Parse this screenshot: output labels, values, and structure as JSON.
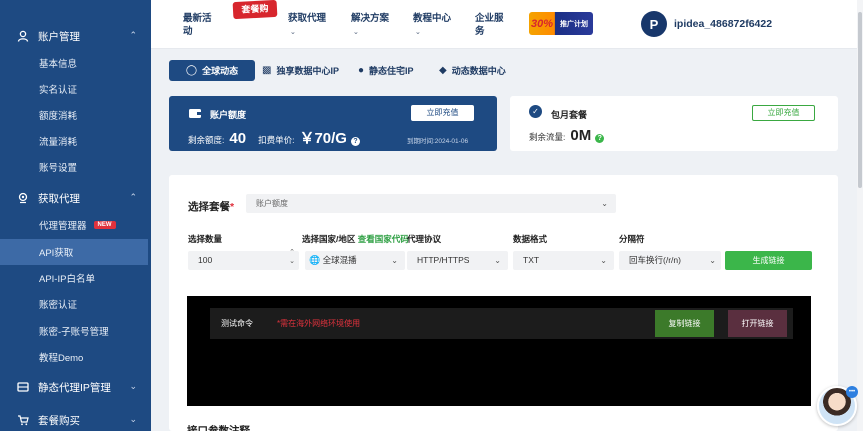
{
  "sidebar": {
    "groups": [
      {
        "label": "账户管理",
        "icon": "user-icon"
      },
      {
        "label": "获取代理",
        "icon": "location-pin-icon"
      },
      {
        "label": "静态代理IP管理",
        "icon": "server-icon"
      },
      {
        "label": "套餐购买",
        "icon": "cart-icon"
      }
    ],
    "account_items": [
      "基本信息",
      "实名认证",
      "额度消耗",
      "流量消耗",
      "账号设置"
    ],
    "proxy_items": [
      "代理管理器",
      "API获取",
      "API-IP白名单",
      "账密认证",
      "账密-子账号管理",
      "教程Demo"
    ],
    "new_badge": "NEW"
  },
  "topbar": {
    "nav": [
      {
        "label": "最新活\n动",
        "has_chevron": false
      },
      {
        "label": "获取代理",
        "has_chevron": true
      },
      {
        "label": "解决方案",
        "has_chevron": true
      },
      {
        "label": "教程中心",
        "has_chevron": true
      },
      {
        "label": "企业服\n务",
        "has_chevron": false
      }
    ],
    "promo_badge": "套餐购",
    "banner_num": "30%",
    "banner_text": "推广计划",
    "logo_letter": "P",
    "username": "ipidea_486872f6422"
  },
  "tabs": [
    {
      "label": "全球动态",
      "icon": "globe-icon"
    },
    {
      "label": "独享数据中心IP",
      "icon": "datacenter-icon"
    },
    {
      "label": "静态住宅IP",
      "icon": "bulb-icon"
    },
    {
      "label": "动态数据中心",
      "icon": "layers-icon"
    }
  ],
  "account_card": {
    "title": "账户额度",
    "button": "立即充值",
    "remaining_label": "剩余额度:",
    "remaining_value": "40",
    "price_label": "扣费单价:",
    "price_value": "￥70/G",
    "expiry": "到期时间:2024-01-06"
  },
  "monthly_card": {
    "title": "包月套餐",
    "button": "立即充值",
    "traffic_label": "剩余流量:",
    "traffic_value": "0M"
  },
  "form": {
    "package_label": "选择套餐",
    "package_required": "*",
    "package_value": "账户额度",
    "quantity_label": "选择数量",
    "quantity_value": "100",
    "region_label": "选择国家/地区",
    "region_link": "查看国家代码",
    "region_value": "全球混播",
    "protocol_label": "代理协议",
    "protocol_value": "HTTP/HTTPS",
    "format_label": "数据格式",
    "format_value": "TXT",
    "separator_label": "分隔符",
    "separator_value": "回车换行(/r/n)",
    "generate_button": "生成链接"
  },
  "console": {
    "label": "测试命令",
    "warning": "*需在海外网络环境使用",
    "copy_button": "复制链接",
    "open_button": "打开链接"
  },
  "params_title": "接口参数注释",
  "colors": {
    "sidebar_bg": "#1e4a82",
    "active_item": "#3d6aa6",
    "accent_green": "#3bb64a",
    "warning_red": "#e0323d"
  }
}
